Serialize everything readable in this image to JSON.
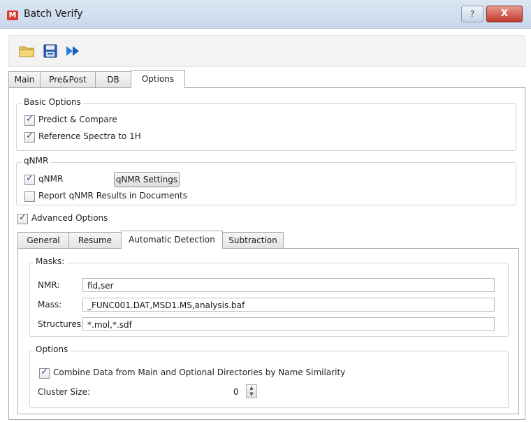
{
  "window": {
    "title": "Batch Verify",
    "logo_letter": "M",
    "help_glyph": "?",
    "close_glyph": "X"
  },
  "toolbar": {
    "icons": [
      "folder-open-icon",
      "save-icon",
      "run-forward-icon"
    ]
  },
  "main_tabs": [
    {
      "label": "Main",
      "active": false
    },
    {
      "label": "Pre&Post",
      "active": false
    },
    {
      "label": "DB",
      "active": false
    },
    {
      "label": "Options",
      "active": true
    }
  ],
  "basic_options": {
    "title": "Basic Options",
    "items": [
      {
        "label": "Predict & Compare",
        "checked": true
      },
      {
        "label": "Reference Spectra to 1H",
        "checked": true
      }
    ]
  },
  "qnmr": {
    "title": "qNMR",
    "checkbox_label": "qNMR",
    "checked": true,
    "settings_button": "qNMR Settings",
    "report_label": "Report qNMR Results in Documents",
    "report_checked": false
  },
  "advanced": {
    "label": "Advanced Options",
    "checked": true
  },
  "sub_tabs": [
    {
      "label": "General",
      "active": false
    },
    {
      "label": "Resume",
      "active": false
    },
    {
      "label": "Automatic Detection",
      "active": true
    },
    {
      "label": "Subtraction",
      "active": false
    }
  ],
  "masks": {
    "title": "Masks:",
    "nmr_label": "NMR:",
    "nmr_value": "fid,ser",
    "mass_label": "Mass:",
    "mass_value": "_FUNC001.DAT,MSD1.MS,analysis.baf",
    "structures_label": "Structures:",
    "structures_value": "*.mol,*.sdf"
  },
  "options": {
    "title": "Options",
    "combine_label": "Combine Data from Main and Optional Directories by Name Similarity",
    "combine_checked": true,
    "cluster_label": "Cluster Size:",
    "cluster_value": "0"
  }
}
